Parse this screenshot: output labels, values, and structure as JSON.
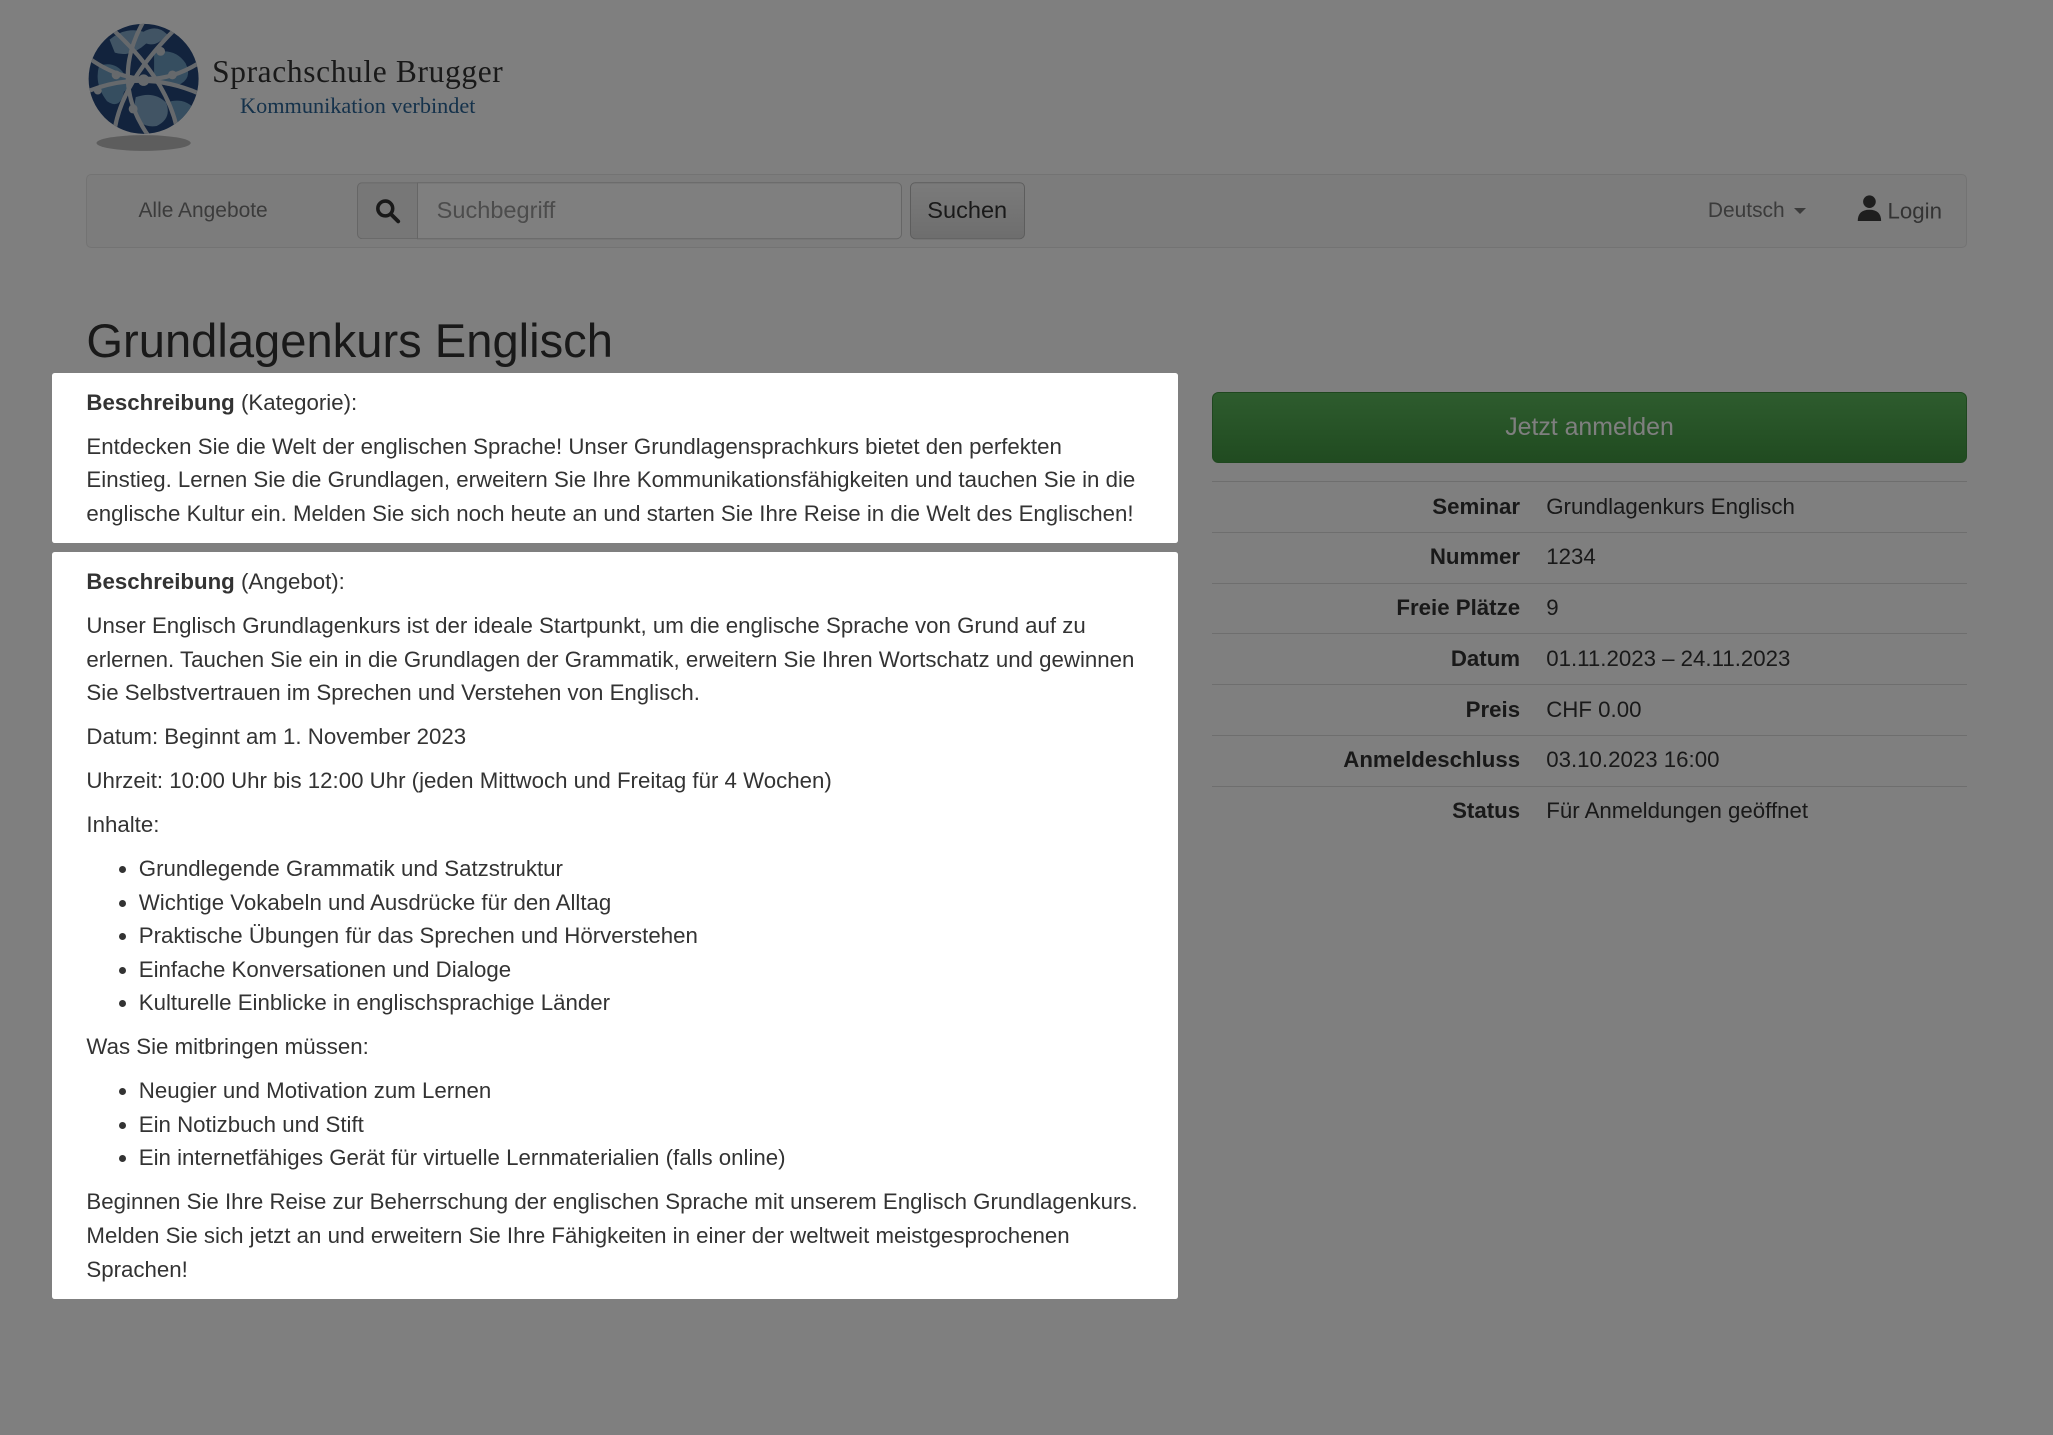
{
  "brand": {
    "title": "Sprachschule Brugger",
    "tagline": "Kommunikation verbindet"
  },
  "navbar": {
    "all_offers_label": "Alle Angebote",
    "search": {
      "placeholder": "Suchbegriff",
      "button_label": "Suchen"
    },
    "language_label": "Deutsch",
    "login_label": "Login"
  },
  "page": {
    "title": "Grundlagenkurs Englisch"
  },
  "description_category": {
    "heading_bold": "Beschreibung",
    "heading_rest": " (Kategorie):",
    "paragraph": "Entdecken Sie die Welt der englischen Sprache! Unser Grundlagensprachkurs bietet den perfekten Einstieg. Lernen Sie die Grundlagen, erweitern Sie Ihre Kommunikationsfähigkeiten und tauchen Sie in die englische Kultur ein. Melden Sie sich noch heute an und starten Sie Ihre Reise in die Welt des Englischen!"
  },
  "description_offer": {
    "heading_bold": "Beschreibung",
    "heading_rest": " (Angebot):",
    "paragraph1": "Unser Englisch Grundlagenkurs ist der ideale Startpunkt, um die englische Sprache von Grund auf zu erlernen. Tauchen Sie ein in die Grundlagen der Grammatik, erweitern Sie Ihren Wortschatz und gewinnen Sie Selbstvertrauen im Sprechen und Verstehen von Englisch.",
    "date_line": "Datum: Beginnt am 1. November 2023",
    "time_line": "Uhrzeit: 10:00 Uhr bis 12:00 Uhr (jeden Mittwoch und Freitag für 4 Wochen)",
    "contents_heading": "Inhalte:",
    "contents_items": [
      "Grundlegende Grammatik und Satzstruktur",
      "Wichtige Vokabeln und Ausdrücke für den Alltag",
      "Praktische Übungen für das Sprechen und Hörverstehen",
      "Einfache Konversationen und Dialoge",
      "Kulturelle Einblicke in englischsprachige Länder"
    ],
    "bring_heading": "Was Sie mitbringen müssen:",
    "bring_items": [
      "Neugier und Motivation zum Lernen",
      "Ein Notizbuch und Stift",
      "Ein internetfähiges Gerät für virtuelle Lernmaterialien (falls online)"
    ],
    "closing_paragraph": "Beginnen Sie Ihre Reise zur Beherrschung der englischen Sprache mit unserem Englisch Grundlagenkurs. Melden Sie sich jetzt an und erweitern Sie Ihre Fähigkeiten in einer der weltweit meistgesprochenen Sprachen!"
  },
  "sidebar": {
    "signup_button_label": "Jetzt anmelden",
    "details": [
      {
        "label": "Seminar",
        "value": "Grundlagenkurs Englisch"
      },
      {
        "label": "Nummer",
        "value": "1234"
      },
      {
        "label": "Freie Plätze",
        "value": "9"
      },
      {
        "label": "Datum",
        "value": "01.11.2023 – 24.11.2023"
      },
      {
        "label": "Preis",
        "value": "CHF 0.00"
      },
      {
        "label": "Anmeldeschluss",
        "value": "03.10.2023 16:00"
      },
      {
        "label": "Status",
        "value": "Für Anmeldungen geöffnet"
      }
    ]
  },
  "colors": {
    "overlay": "rgba(0,0,0,0.5)",
    "accent_green_top": "#5cb85c",
    "accent_green_bottom": "#419641",
    "tagline_blue": "#2a6496",
    "navbar_bg": "#f8f8f8",
    "table_border": "#dddddd"
  }
}
